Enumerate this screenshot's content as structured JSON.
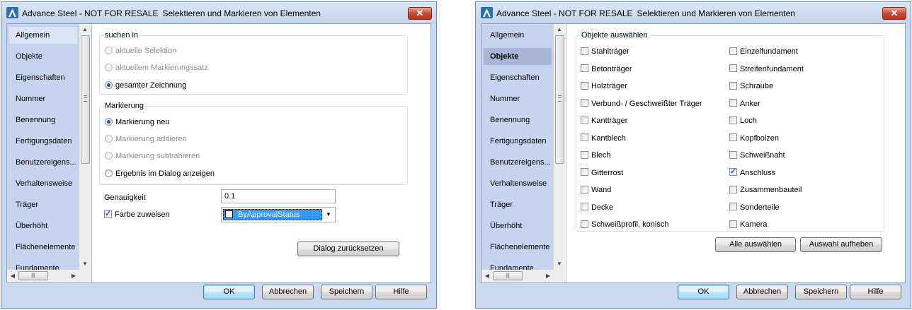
{
  "colors": {
    "title_bar": "#c4d6ee",
    "nav_bg": "#c6d4f0",
    "nav_selected": "#a8b7d8",
    "combo_highlight": "#3399ff",
    "close_button": "#c74a33"
  },
  "dialogs": [
    {
      "title": "Advance Steel - NOT FOR RESALE",
      "subtitle": "Selektieren und Markieren von Elementen",
      "close_label": "✕",
      "nav_items": [
        "Allgemein",
        "Objekte",
        "Eigenschaften",
        "Nummer",
        "Benennung",
        "Fertigungsdaten",
        "Benutzereigens...",
        "Verhaltensweise",
        "Träger",
        "Überhöht",
        "Flächenelemente",
        "Fundamente"
      ],
      "selected_nav": "Allgemein",
      "search_group": {
        "title": "suchen in",
        "options": [
          {
            "label": "aktuelle Selektion",
            "checked": false,
            "enabled": false
          },
          {
            "label": "aktuellem Markierungssatz",
            "checked": false,
            "enabled": false
          },
          {
            "label": "gesamter Zeichnung",
            "checked": true,
            "enabled": true
          }
        ]
      },
      "mark_group": {
        "title": "Markierung",
        "options": [
          {
            "label": "Markierung neu",
            "checked": true,
            "enabled": true
          },
          {
            "label": "Markierung addieren",
            "checked": false,
            "enabled": false
          },
          {
            "label": "Markierung subtrahieren",
            "checked": false,
            "enabled": false
          },
          {
            "label": "Ergebnis im Dialog anzeigen",
            "checked": false,
            "enabled": true
          }
        ]
      },
      "accuracy_label": "Genauigkeit",
      "accuracy_value": "0.1",
      "assign_color_label": "Farbe zuweisen",
      "assign_color_checked": true,
      "color_value": "ByApprovalStatus",
      "reset_button": "Dialog zurücksetzen",
      "buttons": {
        "ok": "OK",
        "cancel": "Abbrechen",
        "save": "Speichern",
        "help": "Hilfe"
      }
    },
    {
      "title": "Advance Steel - NOT FOR RESALE",
      "subtitle": "Selektieren und Markieren von Elementen",
      "close_label": "✕",
      "nav_items": [
        "Allgemein",
        "Objekte",
        "Eigenschaften",
        "Nummer",
        "Benennung",
        "Fertigungsdaten",
        "Benutzereigens...",
        "Verhaltensweise",
        "Träger",
        "Überhöht",
        "Flächenelemente",
        "Fundamente"
      ],
      "selected_nav": "Objekte",
      "objects_group_title": "Objekte auswählen",
      "objects_left": [
        {
          "label": "Stahlträger",
          "checked": false
        },
        {
          "label": "Betonträger",
          "checked": false
        },
        {
          "label": "Holzträger",
          "checked": false
        },
        {
          "label": "Verbund- / Geschweißter Träger",
          "checked": false
        },
        {
          "label": "Kantträger",
          "checked": false
        },
        {
          "label": "Kantblech",
          "checked": false
        },
        {
          "label": "Blech",
          "checked": false
        },
        {
          "label": "Gitterrost",
          "checked": false
        },
        {
          "label": "Wand",
          "checked": false
        },
        {
          "label": "Decke",
          "checked": false
        },
        {
          "label": "Schweißprofil, konisch",
          "checked": false
        }
      ],
      "objects_right": [
        {
          "label": "Einzelfundament",
          "checked": false
        },
        {
          "label": "Streifenfundament",
          "checked": false
        },
        {
          "label": "Schraube",
          "checked": false
        },
        {
          "label": "Anker",
          "checked": false
        },
        {
          "label": "Loch",
          "checked": false
        },
        {
          "label": "Kopfbolzen",
          "checked": false
        },
        {
          "label": "Schweißnaht",
          "checked": false
        },
        {
          "label": "Anschluss",
          "checked": true
        },
        {
          "label": "Zusammenbauteil",
          "checked": false
        },
        {
          "label": "Sonderteile",
          "checked": false
        },
        {
          "label": "Kamera",
          "checked": false
        }
      ],
      "select_all_button": "Alle auswählen",
      "deselect_button": "Auswahl aufheben",
      "buttons": {
        "ok": "OK",
        "cancel": "Abbrechen",
        "save": "Speichern",
        "help": "Hilfe"
      }
    }
  ]
}
